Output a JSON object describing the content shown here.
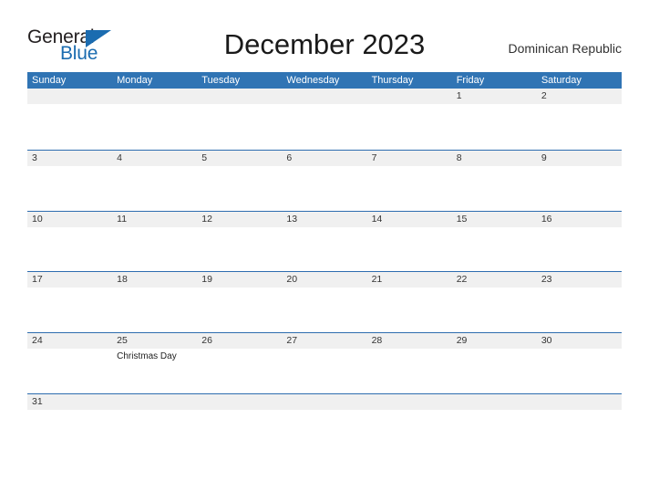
{
  "brand": {
    "name_part1": "General",
    "name_part2": "Blue",
    "triangle_icon": "triangle-icon",
    "primary_color": "#1b6cb0"
  },
  "header": {
    "title": "December 2023",
    "region": "Dominican Republic"
  },
  "calendar": {
    "header_color": "#3074b4",
    "band_color": "#f0f0f0",
    "rule_color": "#2e6daf",
    "weekdays": [
      "Sunday",
      "Monday",
      "Tuesday",
      "Wednesday",
      "Thursday",
      "Friday",
      "Saturday"
    ],
    "weeks": [
      [
        {
          "day": ""
        },
        {
          "day": ""
        },
        {
          "day": ""
        },
        {
          "day": ""
        },
        {
          "day": ""
        },
        {
          "day": "1"
        },
        {
          "day": "2"
        }
      ],
      [
        {
          "day": "3"
        },
        {
          "day": "4"
        },
        {
          "day": "5"
        },
        {
          "day": "6"
        },
        {
          "day": "7"
        },
        {
          "day": "8"
        },
        {
          "day": "9"
        }
      ],
      [
        {
          "day": "10"
        },
        {
          "day": "11"
        },
        {
          "day": "12"
        },
        {
          "day": "13"
        },
        {
          "day": "14"
        },
        {
          "day": "15"
        },
        {
          "day": "16"
        }
      ],
      [
        {
          "day": "17"
        },
        {
          "day": "18"
        },
        {
          "day": "19"
        },
        {
          "day": "20"
        },
        {
          "day": "21"
        },
        {
          "day": "22"
        },
        {
          "day": "23"
        }
      ],
      [
        {
          "day": "24"
        },
        {
          "day": "25",
          "event": "Christmas Day"
        },
        {
          "day": "26"
        },
        {
          "day": "27"
        },
        {
          "day": "28"
        },
        {
          "day": "29"
        },
        {
          "day": "30"
        }
      ],
      [
        {
          "day": "31"
        },
        {
          "day": ""
        },
        {
          "day": ""
        },
        {
          "day": ""
        },
        {
          "day": ""
        },
        {
          "day": ""
        },
        {
          "day": ""
        }
      ]
    ]
  }
}
